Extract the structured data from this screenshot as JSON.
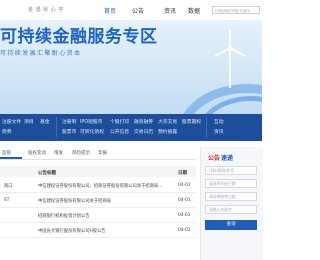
{
  "header": {
    "logo_text": "金 遇 就 心 学",
    "nav": [
      "首页",
      "公告",
      "资讯",
      "数据",
      "服务"
    ],
    "search_placeholder": "代码/简称/拼音/关键字"
  },
  "banner": {
    "title": "可持续金融服务专区",
    "subtitle": "可持续发展汇聚耐心资本"
  },
  "menu": {
    "items_row1": [
      "注册文件",
      "项目",
      "基金",
      "注册制",
      "IPO短股市",
      "个股打印",
      "融资融券",
      "大宗交易",
      "股票期权",
      "互动"
    ],
    "items_row2": [
      "债券",
      "",
      "",
      "股票市",
      "可转化债权",
      "公开信息",
      "交易日历",
      "预约披露",
      "",
      "资讯"
    ]
  },
  "tabs": {
    "items": [
      "监管",
      "股权变动",
      "增发",
      "风险提示",
      "年报"
    ]
  },
  "table": {
    "headers": [
      "",
      "公告标题",
      "日期"
    ],
    "rows": [
      [
        "商口",
        "中信建投证券股份有限公司、招商证券股份有限公司关于招商局...",
        "04-01"
      ],
      [
        "ST",
        "中信建投证券股份有限公司关于招商局",
        "04-01"
      ],
      [
        "",
        "招商银行机构投资计划公告",
        "04-01"
      ],
      [
        "",
        "中国光大银行股份有限公司H股公告",
        "04-01"
      ]
    ]
  },
  "panel": {
    "title_red": "公告",
    "title_blue": "速递",
    "input1": "代码/简称/拼音",
    "input2": "请选择开始日期",
    "input3": "请选择结束日期",
    "input4": "请输入关键字",
    "button": "查询"
  }
}
